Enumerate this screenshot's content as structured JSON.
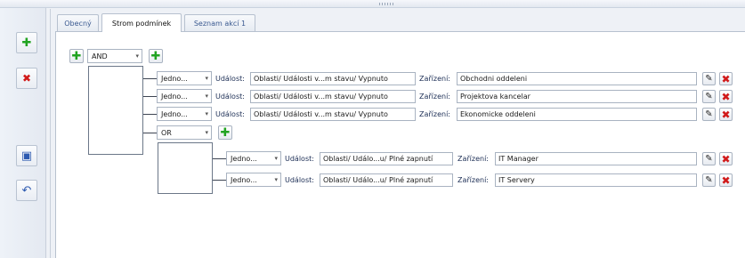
{
  "tabs": [
    "Obecný",
    "Strom podmínek",
    "Seznam akcí 1"
  ],
  "active_tab_index": 1,
  "root": {
    "operator": "AND"
  },
  "labels": {
    "event": "Událost:",
    "device": "Zařízení:"
  },
  "conditions": [
    {
      "type": "Jedno...",
      "event": "Oblasti/ Události v...m stavu/ Vypnuto",
      "device": "Obchodni oddeleni"
    },
    {
      "type": "Jedno...",
      "event": "Oblasti/ Události v...m stavu/ Vypnuto",
      "device": "Projektova kancelar"
    },
    {
      "type": "Jedno...",
      "event": "Oblasti/ Události v...m stavu/ Vypnuto",
      "device": "Ekonomicke oddeleni"
    }
  ],
  "subgroup": {
    "operator": "OR",
    "conditions": [
      {
        "type": "Jedno...",
        "event": "Oblasti/ Událo...u/ Plné zapnutí",
        "device": "IT Manager"
      },
      {
        "type": "Jedno...",
        "event": "Oblasti/ Událo...u/ Plné zapnutí",
        "device": "IT Servery"
      }
    ]
  },
  "icons": {
    "add": "green-plus-icon",
    "remove": "red-x-icon",
    "save": "floppy-disk-icon",
    "undo": "undo-icon",
    "edit": "edit-icon"
  },
  "colors": {
    "green": "#21a321",
    "red": "#d11a1a",
    "blue": "#2d5ab0"
  }
}
